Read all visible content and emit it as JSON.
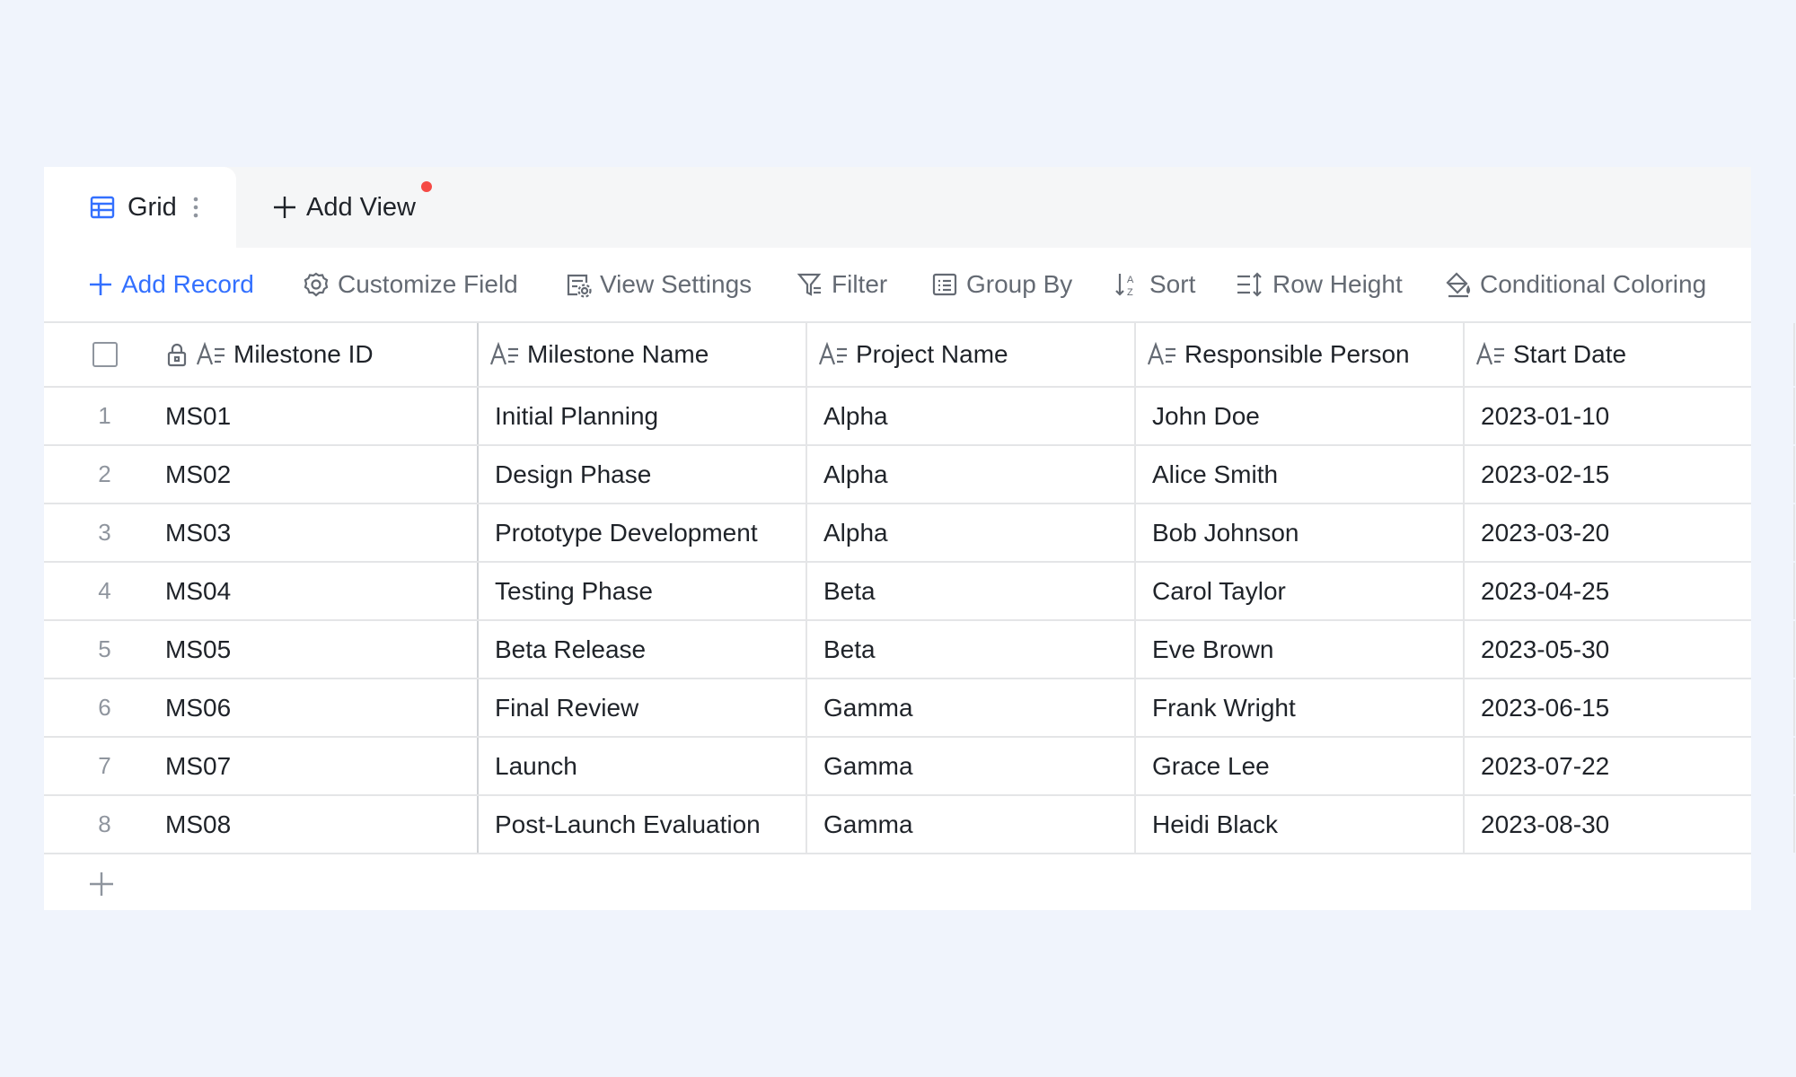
{
  "tabs": {
    "active": {
      "label": "Grid",
      "icon": "grid-icon"
    },
    "add_view": "Add View"
  },
  "toolbar": {
    "add_record": "Add Record",
    "customize_field": "Customize Field",
    "view_settings": "View Settings",
    "filter": "Filter",
    "group_by": "Group By",
    "sort": "Sort",
    "row_height": "Row Height",
    "conditional_coloring": "Conditional Coloring"
  },
  "table": {
    "columns": [
      "Milestone ID",
      "Milestone Name",
      "Project Name",
      "Responsible Person",
      "Start Date"
    ],
    "rows": [
      {
        "num": "1",
        "id": "MS01",
        "name": "Initial Planning",
        "project": "Alpha",
        "person": "John Doe",
        "date": "2023-01-10"
      },
      {
        "num": "2",
        "id": "MS02",
        "name": "Design Phase",
        "project": "Alpha",
        "person": "Alice Smith",
        "date": "2023-02-15"
      },
      {
        "num": "3",
        "id": "MS03",
        "name": "Prototype Development",
        "project": "Alpha",
        "person": "Bob Johnson",
        "date": "2023-03-20"
      },
      {
        "num": "4",
        "id": "MS04",
        "name": "Testing Phase",
        "project": "Beta",
        "person": "Carol Taylor",
        "date": "2023-04-25"
      },
      {
        "num": "5",
        "id": "MS05",
        "name": "Beta Release",
        "project": "Beta",
        "person": "Eve Brown",
        "date": "2023-05-30"
      },
      {
        "num": "6",
        "id": "MS06",
        "name": "Final Review",
        "project": "Gamma",
        "person": "Frank Wright",
        "date": "2023-06-15"
      },
      {
        "num": "7",
        "id": "MS07",
        "name": "Launch",
        "project": "Gamma",
        "person": "Grace Lee",
        "date": "2023-07-22"
      },
      {
        "num": "8",
        "id": "MS08",
        "name": "Post-Launch Evaluation",
        "project": "Gamma",
        "person": "Heidi Black",
        "date": "2023-08-30"
      }
    ]
  },
  "colors": {
    "accent": "#3370ff",
    "notification_dot": "#f54a45",
    "background": "#f0f4fc"
  }
}
